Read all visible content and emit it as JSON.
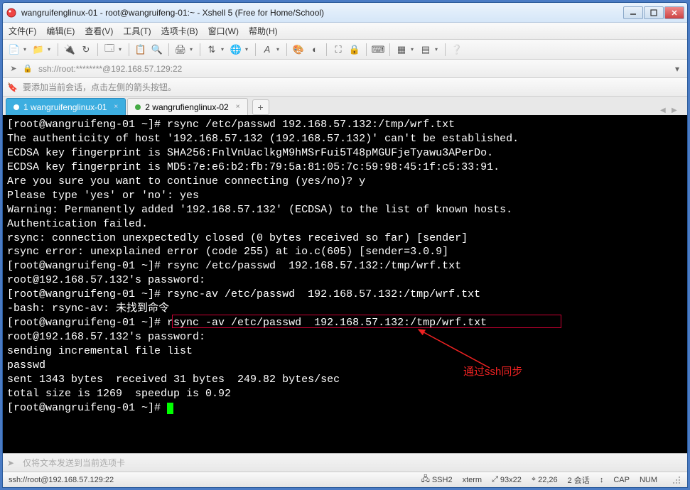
{
  "window": {
    "title": "wangruifenglinux-01 - root@wangruifeng-01:~ - Xshell 5 (Free for Home/School)"
  },
  "menu": {
    "file": "文件(F)",
    "edit": "编辑(E)",
    "view": "查看(V)",
    "tools": "工具(T)",
    "tab": "选项卡(B)",
    "window": "窗口(W)",
    "help": "帮助(H)"
  },
  "address": {
    "text": "ssh://root:********@192.168.57.129:22"
  },
  "hint": {
    "text": "要添加当前会话，点击左侧的箭头按钮。"
  },
  "tabs": [
    {
      "label": "1 wangruifenglinux-01",
      "active": true
    },
    {
      "label": "2 wangrufienglinux-02",
      "active": false
    }
  ],
  "terminal": {
    "lines": [
      "[root@wangruifeng-01 ~]# rsync /etc/passwd 192.168.57.132:/tmp/wrf.txt",
      "The authenticity of host '192.168.57.132 (192.168.57.132)' can't be established.",
      "ECDSA key fingerprint is SHA256:FnlVnUaclkgM9hMSrFui5T48pMGUFjeTyawu3APerDo.",
      "ECDSA key fingerprint is MD5:7e:e6:b2:fb:79:5a:81:05:7c:59:98:45:1f:c5:33:91.",
      "Are you sure you want to continue connecting (yes/no)? y",
      "Please type 'yes' or 'no': yes",
      "Warning: Permanently added '192.168.57.132' (ECDSA) to the list of known hosts.",
      "Authentication failed.",
      "rsync: connection unexpectedly closed (0 bytes received so far) [sender]",
      "rsync error: unexplained error (code 255) at io.c(605) [sender=3.0.9]",
      "[root@wangruifeng-01 ~]# rsync /etc/passwd  192.168.57.132:/tmp/wrf.txt",
      "root@192.168.57.132's password:",
      "[root@wangruifeng-01 ~]# rsync-av /etc/passwd  192.168.57.132:/tmp/wrf.txt",
      "-bash: rsync-av: 未找到命令",
      "[root@wangruifeng-01 ~]# rsync -av /etc/passwd  192.168.57.132:/tmp/wrf.txt",
      "root@192.168.57.132's password:",
      "sending incremental file list",
      "passwd",
      "",
      "sent 1343 bytes  received 31 bytes  249.82 bytes/sec",
      "total size is 1269  speedup is 0.92",
      "[root@wangruifeng-01 ~]# "
    ],
    "annotation": "通过ssh同步"
  },
  "inputbar": {
    "placeholder": "仅将文本发送到当前选项卡"
  },
  "status": {
    "conn": "ssh://root@192.168.57.129:22",
    "proto": "SSH2",
    "term": "xterm",
    "size": "93x22",
    "pos": "22,26",
    "sessions": "2 会话",
    "cap": "CAP",
    "num": "NUM"
  }
}
